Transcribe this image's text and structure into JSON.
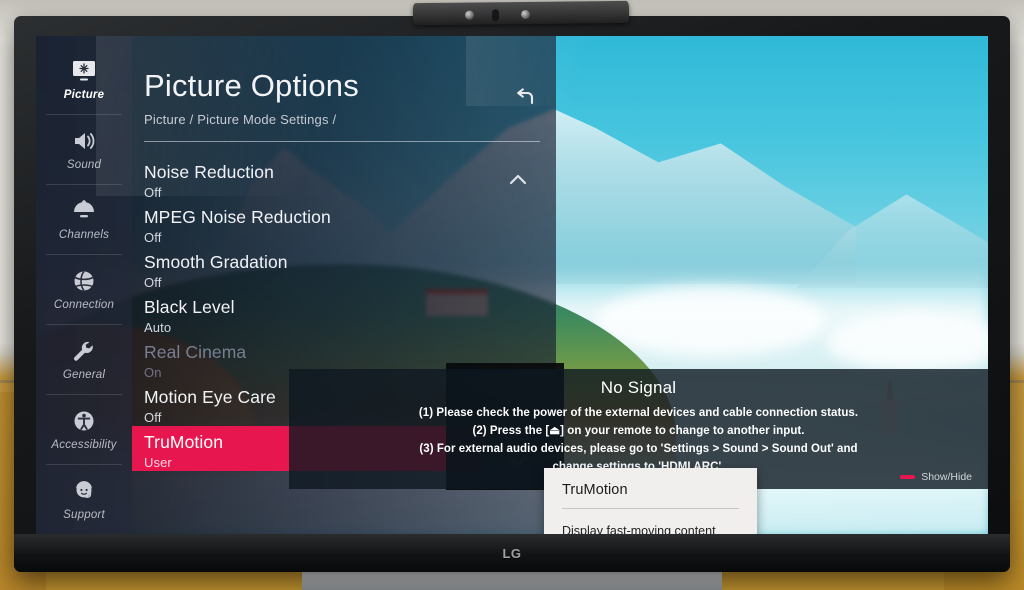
{
  "device": {
    "brand_logo": "LG",
    "camera_bar_icon": "webcam-soundbar"
  },
  "sidebar": {
    "items": [
      {
        "label": "Picture",
        "icon": "picture-icon",
        "active": true,
        "disabled": false
      },
      {
        "label": "Sound",
        "icon": "speaker-icon",
        "active": false,
        "disabled": false
      },
      {
        "label": "Channels",
        "icon": "satellite-dish-icon",
        "active": false,
        "disabled": false
      },
      {
        "label": "Connection",
        "icon": "globe-network-icon",
        "active": false,
        "disabled": false
      },
      {
        "label": "General",
        "icon": "wrench-icon",
        "active": false,
        "disabled": false
      },
      {
        "label": "Accessibility",
        "icon": "accessibility-icon",
        "active": false,
        "disabled": false
      },
      {
        "label": "Support",
        "icon": "support-agent-icon",
        "active": false,
        "disabled": false
      }
    ]
  },
  "content": {
    "title": "Picture Options",
    "breadcrumb": "Picture / Picture Mode Settings /",
    "back_icon": "back-arrow-icon",
    "scroll_up_icon": "chevron-up-icon",
    "scroll_down_icon": "chevron-down-icon",
    "accent_color": "#e8164e",
    "options": [
      {
        "name": "Noise Reduction",
        "value": "Off",
        "selected": false,
        "disabled": false
      },
      {
        "name": "MPEG Noise Reduction",
        "value": "Off",
        "selected": false,
        "disabled": false
      },
      {
        "name": "Smooth Gradation",
        "value": "Off",
        "selected": false,
        "disabled": false
      },
      {
        "name": "Black Level",
        "value": "Auto",
        "selected": false,
        "disabled": false
      },
      {
        "name": "Real Cinema",
        "value": "On",
        "selected": false,
        "disabled": true
      },
      {
        "name": "Motion Eye Care",
        "value": "Off",
        "selected": false,
        "disabled": false
      },
      {
        "name": "TruMotion",
        "value": "User",
        "selected": true,
        "disabled": false
      }
    ]
  },
  "no_signal": {
    "title": "No Signal",
    "lines": [
      "(1) Please check the power of the external devices and cable connection status.",
      "(2) Press the [⏏] on your remote to change to another input.",
      "(3) For external audio devices, please go to 'Settings > Sound > Sound Out' and",
      "change settings to 'HDMI ARC'."
    ],
    "footer_label": "Show/Hide",
    "footer_key_color": "#e8164e"
  },
  "tooltip": {
    "title": "TruMotion",
    "description": "Display fast-moving content smoothly and clearly."
  },
  "wallpaper": {
    "scene": "mountain-lake-landscape"
  }
}
